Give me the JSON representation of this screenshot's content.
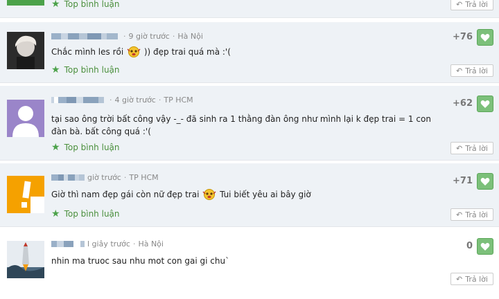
{
  "ui": {
    "top_comments_label": "Top bình luận",
    "reply_label": "Trả lời"
  },
  "comments": [
    {
      "time": "",
      "location": "",
      "text": "",
      "score": ""
    },
    {
      "time": "9 giờ trước",
      "location": "Hà Nội",
      "text_before_emoji": "Chắc mình les rồi",
      "text_after_emoji": ")) đẹp trai quá mà :'(",
      "score": "+76"
    },
    {
      "time": "4 giờ trước",
      "location": "TP HCM",
      "text": "tại sao ông trời bất công vậy -_- đã sinh ra 1 thằng đàn ông như mình lại k đẹp trai = 1 con đàn bà. bất công quá :'(",
      "score": "+62"
    },
    {
      "time": "giờ trước",
      "location": "TP HCM",
      "text_before_emoji": "Giờ thì nam đẹp gái còn nữ đẹp trai",
      "text_after_emoji": "Tui biết yêu ai bây giờ",
      "score": "+71"
    },
    {
      "time": "l giây trước",
      "location": "Hà Nội",
      "text": "nhin ma truoc sau nhu mot con gai gi chu`",
      "score": "0"
    }
  ],
  "colors": {
    "accent_green": "#4a8f3c",
    "like_button": "#7cc07a",
    "row_blue": "#eef2f6"
  }
}
